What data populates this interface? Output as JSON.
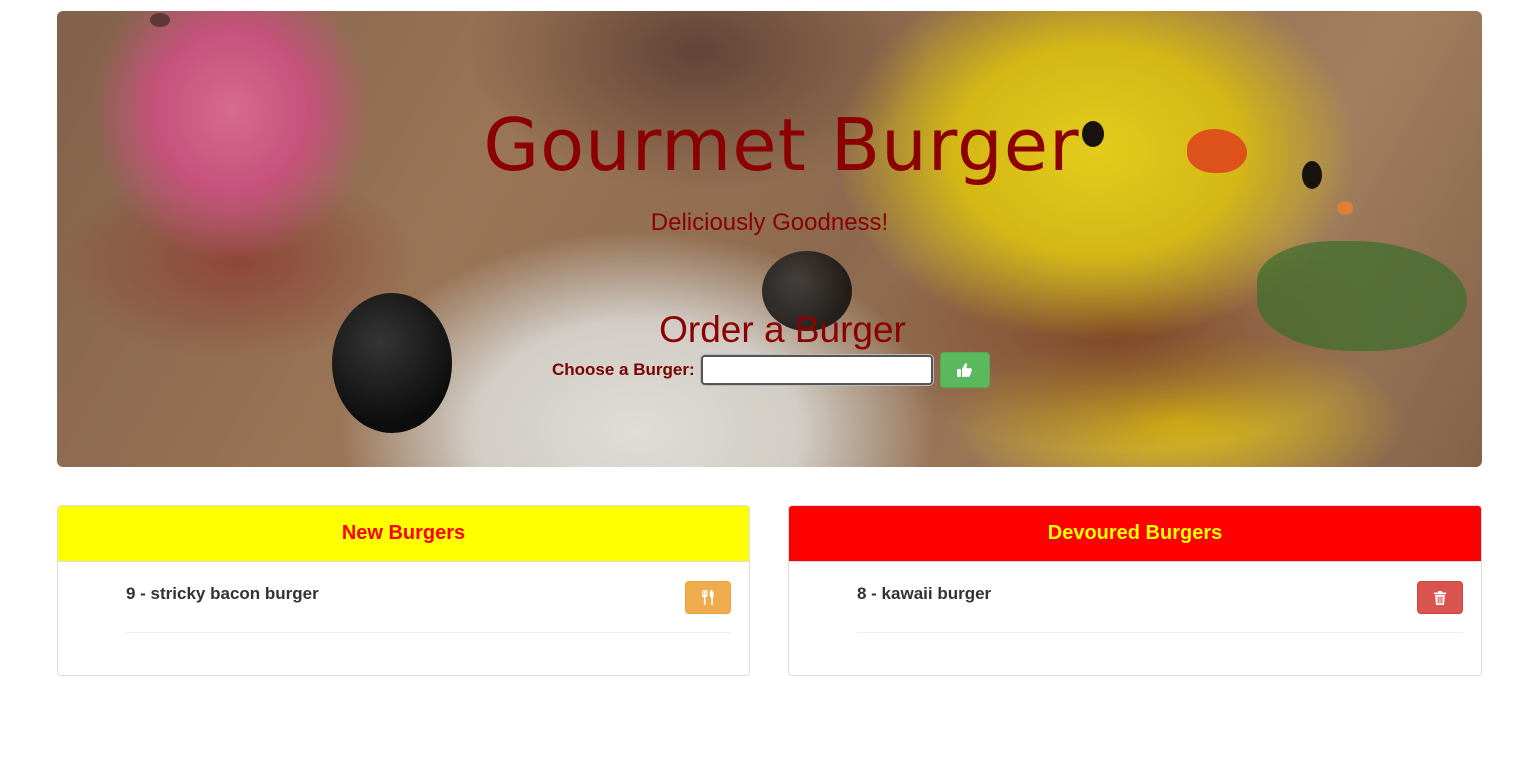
{
  "header": {
    "title": "Gourmet Burger",
    "subtitle": "Deliciously Goodness!"
  },
  "order": {
    "heading": "Order a Burger",
    "label": "Choose a Burger:",
    "input_value": "",
    "submit_icon": "thumbs-up-icon"
  },
  "new_burgers": {
    "heading": "New Burgers",
    "heading_bg": "#ffff00",
    "heading_color": "#ff0000",
    "items": [
      {
        "text": "9 - stricky bacon burger",
        "action_icon": "cutlery-icon"
      }
    ]
  },
  "devoured_burgers": {
    "heading": "Devoured Burgers",
    "heading_bg": "#ff0000",
    "heading_color": "#ffff00",
    "items": [
      {
        "text": "8 - kawaii burger",
        "action_icon": "trash-icon"
      }
    ]
  },
  "colors": {
    "accent": "#8b0000",
    "success": "#5cb85c",
    "warning": "#f0ad4e",
    "danger": "#d9534f"
  }
}
